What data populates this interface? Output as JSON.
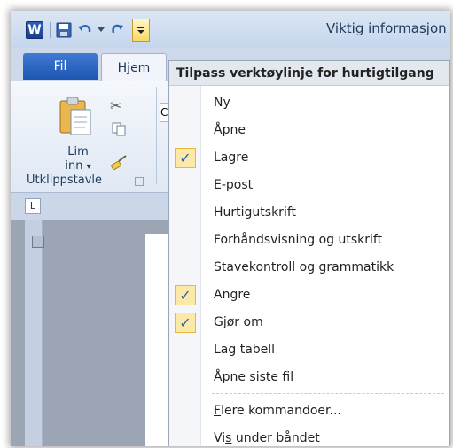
{
  "window": {
    "app_icon_letter": "W",
    "title": "Viktig informasjon ti"
  },
  "qat": {
    "icons": [
      "word-app-icon",
      "save-icon",
      "undo-icon",
      "dropdown-arrow-icon",
      "redo-icon",
      "customize-qat-icon"
    ]
  },
  "ribbon": {
    "tabs": {
      "file": "Fil",
      "home": "Hjem",
      "next_partial": "e"
    },
    "clipboard": {
      "paste_line1": "Lim",
      "paste_line2": "inn",
      "paste_arrow": "▾",
      "group_label": "Utklippstavle"
    },
    "font_box_partial": "C"
  },
  "ruler": {
    "tab_selector": "L"
  },
  "menu": {
    "header": "Tilpass verktøylinje for hurtigtilgang",
    "items": [
      {
        "label": "Ny",
        "checked": false
      },
      {
        "label": "Åpne",
        "checked": false
      },
      {
        "label": "Lagre",
        "checked": true
      },
      {
        "label": "E-post",
        "checked": false
      },
      {
        "label": "Hurtigutskrift",
        "checked": false
      },
      {
        "label": "Forhåndsvisning og utskrift",
        "checked": false
      },
      {
        "label": "Stavekontroll og grammatikk",
        "checked": false
      },
      {
        "label": "Angre",
        "checked": true
      },
      {
        "label": "Gjør om",
        "checked": true
      },
      {
        "label": "Lag tabell",
        "checked": false
      },
      {
        "label": "Åpne siste fil",
        "checked": false
      }
    ],
    "more_commands": {
      "mnemonic": "F",
      "rest": "lere kommandoer..."
    },
    "show_below": {
      "before": "Vi",
      "mnemonic": "s",
      "after": " under båndet"
    },
    "check_glyph": "✓"
  },
  "colors": {
    "accent_check_bg": "#fde9a7",
    "file_tab": "#2b63c0",
    "font_color_bar": "#d42a1f"
  }
}
